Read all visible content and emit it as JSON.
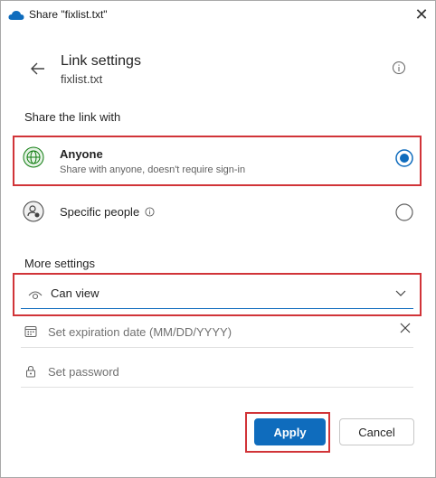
{
  "window": {
    "title": "Share \"fixlist.txt\""
  },
  "header": {
    "title": "Link settings",
    "subtitle": "fixlist.txt"
  },
  "share_with": {
    "label": "Share the link with",
    "options": [
      {
        "title": "Anyone",
        "description": "Share with anyone, doesn't require sign-in",
        "selected": true
      },
      {
        "title": "Specific people",
        "description": "",
        "selected": false
      }
    ]
  },
  "more_settings": {
    "label": "More settings",
    "permission": {
      "value": "Can view"
    },
    "expiration": {
      "placeholder": "Set expiration date (MM/DD/YYYY)",
      "value": ""
    },
    "password": {
      "placeholder": "Set password",
      "value": ""
    }
  },
  "actions": {
    "apply_label": "Apply",
    "cancel_label": "Cancel"
  },
  "colors": {
    "accent": "#0f6cbd",
    "highlight": "#d13438"
  }
}
